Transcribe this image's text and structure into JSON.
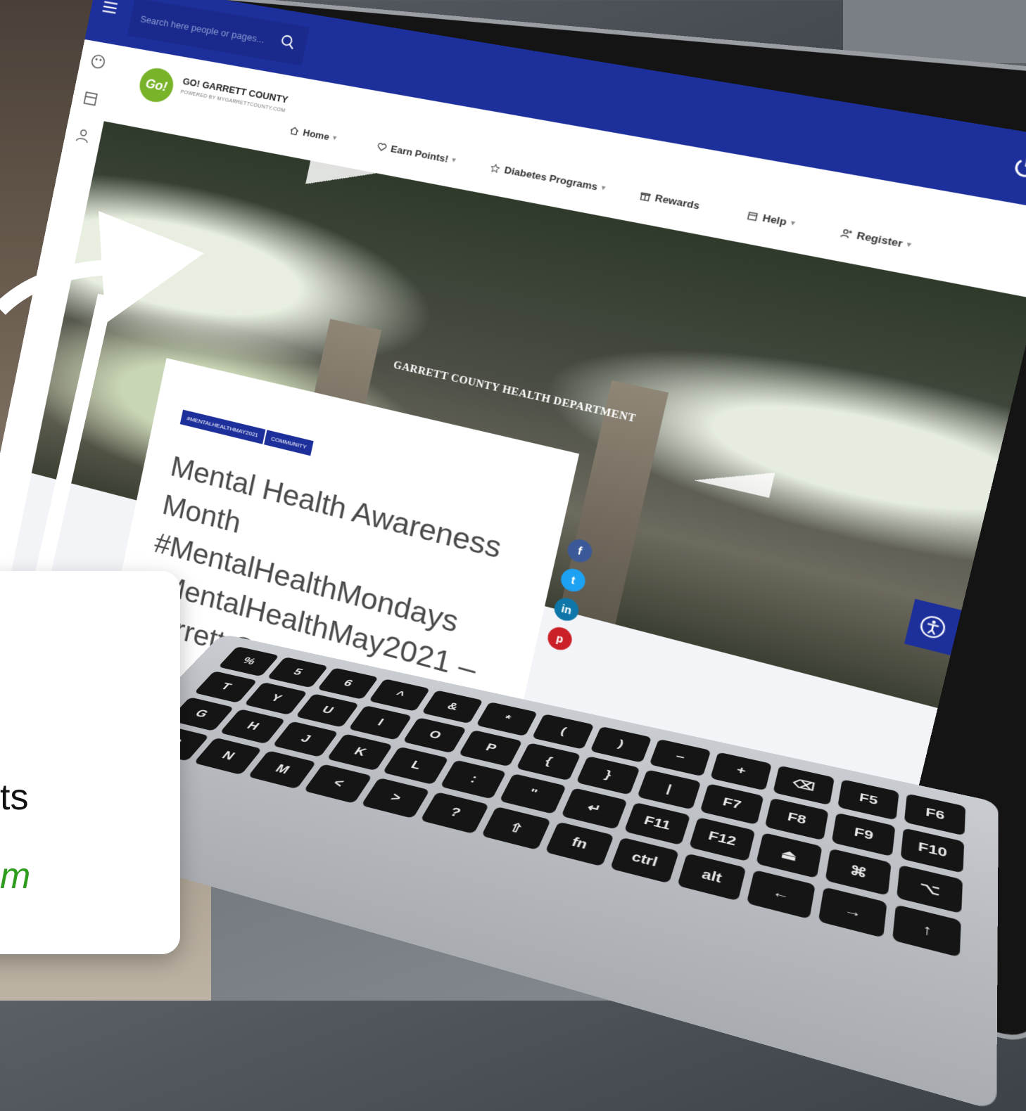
{
  "site": {
    "logo_badge": "Go!",
    "logo_title": "GO! GARRETT COUNTY",
    "logo_subtitle": "POWERED BY MYGARRETTCOUNTY.COM",
    "search_placeholder": "Search here people or pages..."
  },
  "nav": {
    "items": [
      {
        "label": "Home",
        "icon": "home-icon",
        "has_dropdown": true
      },
      {
        "label": "Earn Points!",
        "icon": "heart-icon",
        "has_dropdown": true
      },
      {
        "label": "Diabetes Programs",
        "icon": "star-icon",
        "has_dropdown": true
      },
      {
        "label": "Rewards",
        "icon": "gift-icon",
        "has_dropdown": false
      },
      {
        "label": "Help",
        "icon": "calendar-icon",
        "has_dropdown": true
      },
      {
        "label": "Register",
        "icon": "user-plus-icon",
        "has_dropdown": true
      }
    ],
    "caret": "▾"
  },
  "hero": {
    "building_sign": "GARRETT COUNTY HEALTH DEPARTMENT"
  },
  "article": {
    "tags": [
      "#MENTALHEALTHMAY2021",
      "COMMUNITY"
    ],
    "title_lines": [
      "Mental Health Awareness",
      "Month #MentalHealthMondays",
      "#MentalHealthMay2021 –",
      "Garrett County Behavioral"
    ]
  },
  "social": [
    {
      "name": "facebook",
      "glyph": "f",
      "color": "#3b5998"
    },
    {
      "name": "twitter",
      "glyph": "t",
      "color": "#1da1f2"
    },
    {
      "name": "linkedin",
      "glyph": "in",
      "color": "#0e76a8"
    },
    {
      "name": "pinterest",
      "glyph": "p",
      "color": "#cb2027"
    }
  ],
  "callout": {
    "line1": "ts",
    "line2": "m"
  },
  "colors": {
    "brand_blue": "#1d2f9b",
    "brand_green": "#79b32a",
    "accent_green_text": "#2e9c1c"
  },
  "keyboard": {
    "keys": [
      "%",
      "5",
      "6",
      "^",
      "&",
      "*",
      "(",
      ")",
      "−",
      "+",
      "⌫",
      "F5",
      "F6",
      "T",
      "Y",
      "U",
      "I",
      "O",
      "P",
      "{",
      "}",
      "|",
      "F7",
      "F8",
      "F9",
      "F10",
      "G",
      "H",
      "J",
      "K",
      "L",
      ":",
      "\"",
      "↵",
      "F11",
      "F12",
      "⏏",
      "⌘",
      "⌥",
      "B",
      "N",
      "M",
      "<",
      ">",
      "?",
      "⇧",
      "fn",
      "ctrl",
      "alt",
      "←",
      "→",
      "↑"
    ]
  }
}
